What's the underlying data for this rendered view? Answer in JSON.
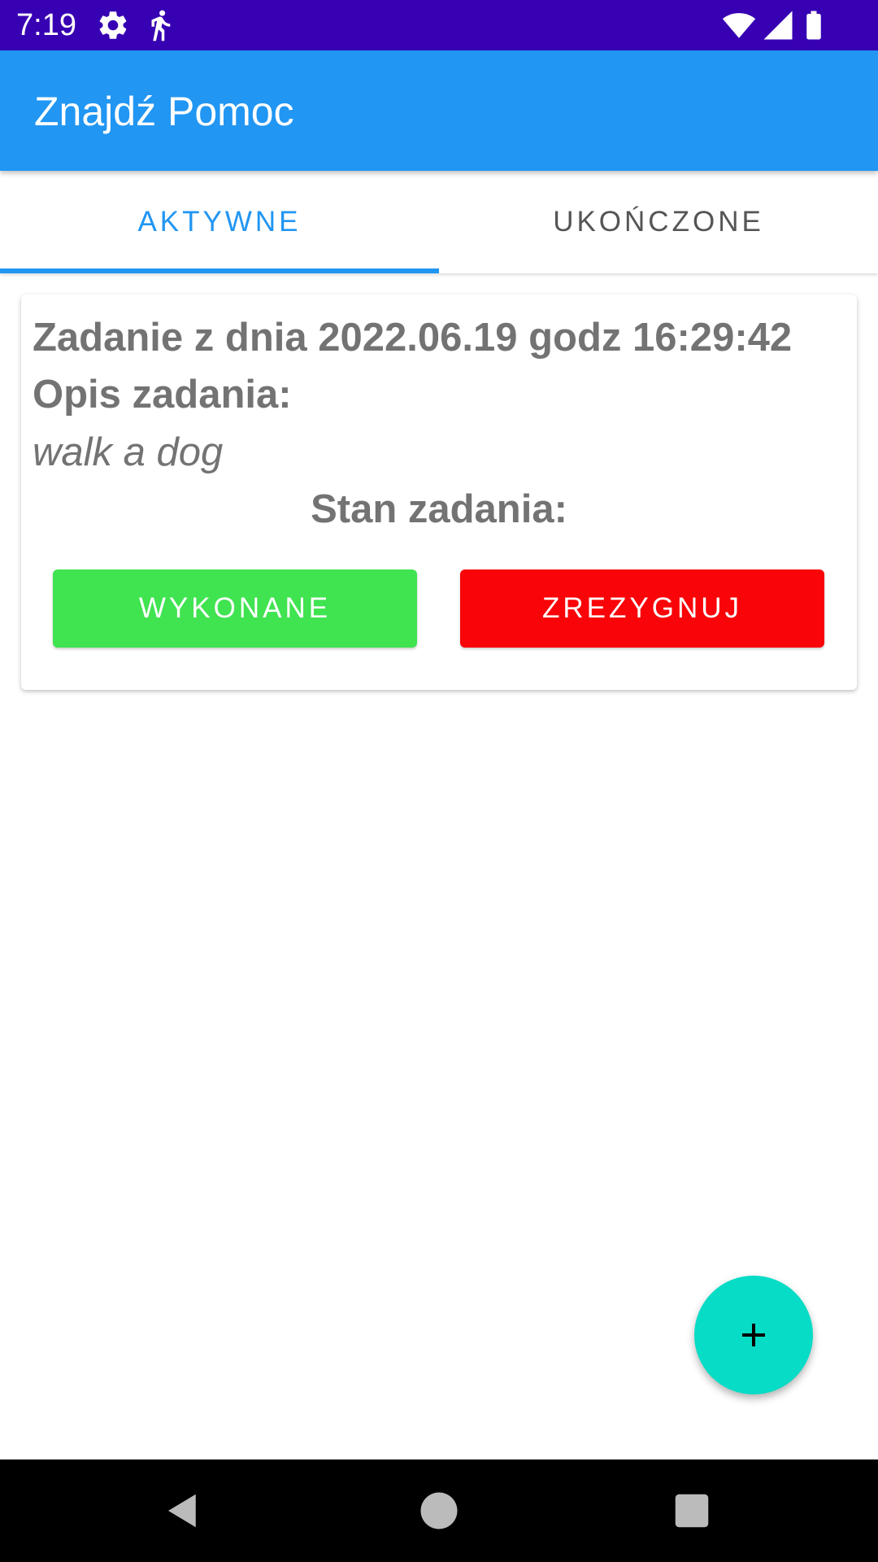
{
  "status_bar": {
    "time": "7:19",
    "left_icons": [
      "gear-icon",
      "walking-person-icon"
    ],
    "right_icons": [
      "wifi-icon",
      "cellular-signal-icon",
      "battery-icon"
    ],
    "background": "#3700B3"
  },
  "app_bar": {
    "title": "Znajdź Pomoc",
    "background": "#2196F3"
  },
  "tabs": [
    {
      "label": "AKTYWNE",
      "active": true
    },
    {
      "label": "UKOŃCZONE",
      "active": false
    }
  ],
  "task_card": {
    "date_line": "Zadanie z dnia 2022.06.19 godz 16:29:42",
    "description_label": "Opis zadania:",
    "description_value": "walk a dog",
    "status_label": "Stan zadania:",
    "done_button": "WYKONANE",
    "resign_button": "ZREZYGNUJ"
  },
  "fab": {
    "icon": "plus-icon",
    "color": "#07DCC6"
  },
  "nav_bar": {
    "icons": [
      "back-icon",
      "home-icon",
      "recents-icon"
    ]
  },
  "colors": {
    "accent": "#2196F3",
    "done": "#40E350",
    "resign": "#F90408",
    "card_text": "#737373"
  }
}
